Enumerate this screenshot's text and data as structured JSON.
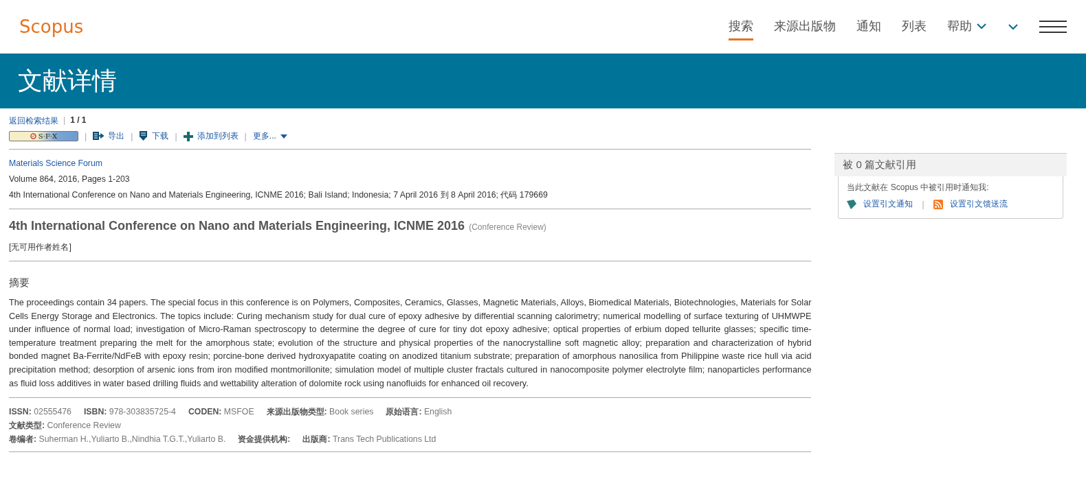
{
  "header": {
    "logo": "Scopus",
    "nav": [
      {
        "label": "搜索",
        "selected": true,
        "dropdown": false
      },
      {
        "label": "来源出版物",
        "selected": false,
        "dropdown": false
      },
      {
        "label": "通知",
        "selected": false,
        "dropdown": false
      },
      {
        "label": "列表",
        "selected": false,
        "dropdown": false
      },
      {
        "label": "帮助",
        "selected": false,
        "dropdown": true
      }
    ]
  },
  "banner": {
    "title": "文献详情"
  },
  "breadcrumb": {
    "link": "返回检索结果",
    "separator": "|",
    "position": "1 / 1"
  },
  "toolbar": {
    "sfx_label": "S·F·X",
    "separator": "|",
    "actions": [
      {
        "kind": "export",
        "label": "导出"
      },
      {
        "kind": "download",
        "label": "下载"
      },
      {
        "kind": "add",
        "label": "添加到列表"
      },
      {
        "kind": "more",
        "label": "更多..."
      }
    ]
  },
  "source": {
    "title": "Materials Science Forum",
    "volume": "Volume 864, 2016, Pages 1-203",
    "conference": "4th International Conference on Nano and Materials Engineering, ICNME 2016; Bali Island; Indonesia; 7 April 2016 到 8 April 2016; 代码 179669"
  },
  "document": {
    "title": "4th International Conference on Nano and Materials Engineering, ICNME 2016",
    "type": "(Conference Review)",
    "authors": "[无可用作者姓名]"
  },
  "abstract": {
    "heading": "摘要",
    "text": "The proceedings contain 34 papers. The special focus in this conference is on Polymers, Composites, Ceramics, Glasses, Magnetic Materials, Alloys, Biomedical Materials, Biotechnologies, Materials for Solar Cells Energy Storage and Electronics. The topics include: Curing mechanism study for dual cure of epoxy adhesive by differential scanning calorimetry; numerical modelling of surface texturing of UHMWPE under influence of normal load; investigation of Micro-Raman spectroscopy to determine the degree of cure for tiny dot epoxy adhesive; optical properties of erbium doped tellurite glasses; specific time-temperature treatment preparing the melt for the amorphous state; evolution of the structure and physical properties of the nanocrystalline soft magnetic alloy; preparation and characterization of hybrid bonded magnet Ba-Ferrite/NdFeB with epoxy resin; porcine-bone derived hydroxyapatite coating on anodized titanium substrate; preparation of amorphous nanosilica from Philippine waste rice hull via acid precipitation method; desorption of arsenic ions from iron modified montmorillonite; simulation model of multiple cluster fractals cultured in nanocomposite polymer electrolyte film; nanoparticles performance as fluid loss additives in water based drilling fluids and wettability alteration of dolomite rock using nanofluids for enhanced oil recovery."
  },
  "metadata": [
    [
      {
        "label": "ISSN:",
        "value": "02555476"
      },
      {
        "label": "ISBN:",
        "value": "978-303835725-4"
      },
      {
        "label": "CODEN:",
        "value": "MSFOE"
      },
      {
        "label": "来源出版物类型:",
        "value": "Book series"
      },
      {
        "label": "原始语言:",
        "value": "English"
      }
    ],
    [
      {
        "label": "文献类型:",
        "value": "Conference Review"
      }
    ],
    [
      {
        "label": "卷编者:",
        "value": "Suherman H.,Yuliarto B.,Nindhia T.G.T.,Yuliarto B."
      },
      {
        "label": "资金提供机构:"
      },
      {
        "label": "出版商:",
        "value": "Trans Tech Publications Ltd"
      }
    ]
  ],
  "citations": {
    "title": "被 0 篇文献引用",
    "separator": "|",
    "notice": "当此文献在 Scopus 中被引用时通知我:",
    "links": [
      {
        "kind": "alert",
        "label": "设置引文通知"
      },
      {
        "kind": "feed",
        "label": "设置引文馈送流"
      }
    ]
  }
}
